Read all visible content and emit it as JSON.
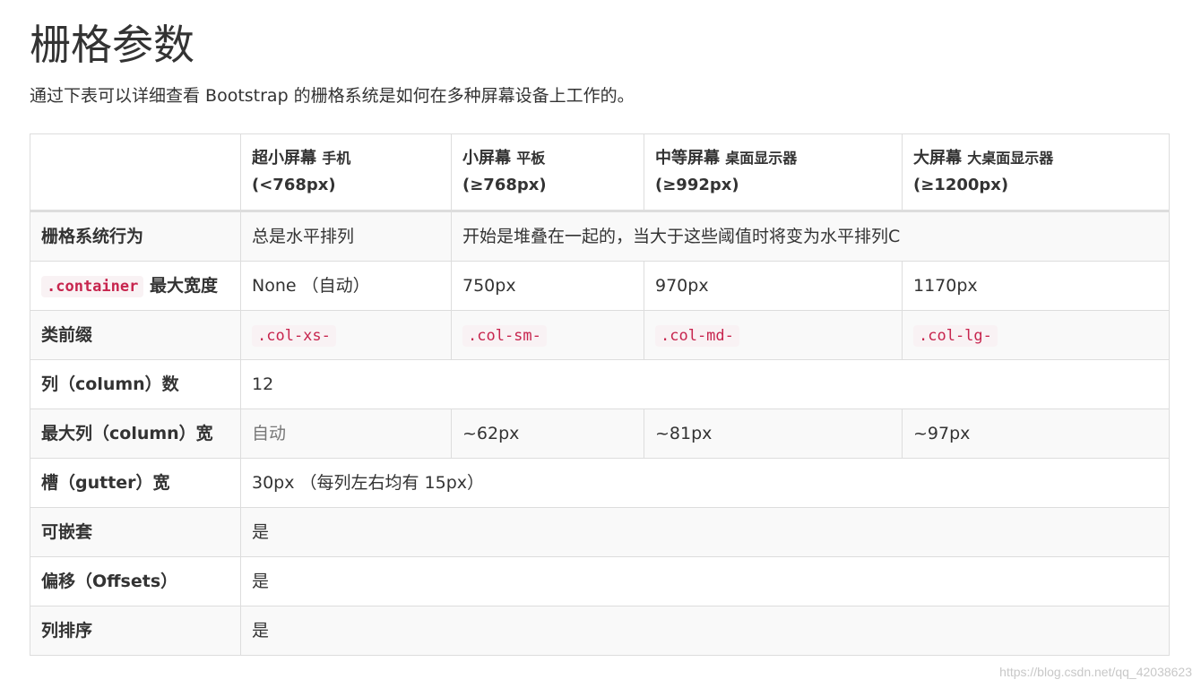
{
  "page": {
    "title": "栅格参数",
    "lead": "通过下表可以详细查看 Bootstrap 的栅格系统是如何在多种屏幕设备上工作的。"
  },
  "table": {
    "headers": [
      {
        "main": "",
        "small": "",
        "range": ""
      },
      {
        "main": "超小屏幕",
        "small": "手机",
        "range": "(<768px)"
      },
      {
        "main": "小屏幕",
        "small": "平板",
        "range": "(≥768px)"
      },
      {
        "main": "中等屏幕",
        "small": "桌面显示器",
        "range": "(≥992px)"
      },
      {
        "main": "大屏幕",
        "small": "大桌面显示器",
        "range": "(≥1200px)"
      }
    ],
    "rows": {
      "behavior": {
        "label": "栅格系统行为",
        "xs": "总是水平排列",
        "rest": "开始是堆叠在一起的，当大于这些阈值时将变为水平排列C"
      },
      "container": {
        "code": ".container",
        "label": "最大宽度",
        "xs": "None （自动）",
        "sm": "750px",
        "md": "970px",
        "lg": "1170px"
      },
      "prefix": {
        "label": "类前缀",
        "xs": ".col-xs-",
        "sm": ".col-sm-",
        "md": ".col-md-",
        "lg": ".col-lg-"
      },
      "columns": {
        "label": "列（column）数",
        "value": "12"
      },
      "max_col": {
        "label": "最大列（column）宽",
        "xs": "自动",
        "sm": "~62px",
        "md": "~81px",
        "lg": "~97px"
      },
      "gutter": {
        "label": "槽（gutter）宽",
        "value": "30px （每列左右均有 15px）"
      },
      "nestable": {
        "label": "可嵌套",
        "value": "是"
      },
      "offsets": {
        "label": "偏移（Offsets）",
        "value": "是"
      },
      "ordering": {
        "label": "列排序",
        "value": "是"
      }
    }
  },
  "watermark": "https://blog.csdn.net/qq_42038623"
}
